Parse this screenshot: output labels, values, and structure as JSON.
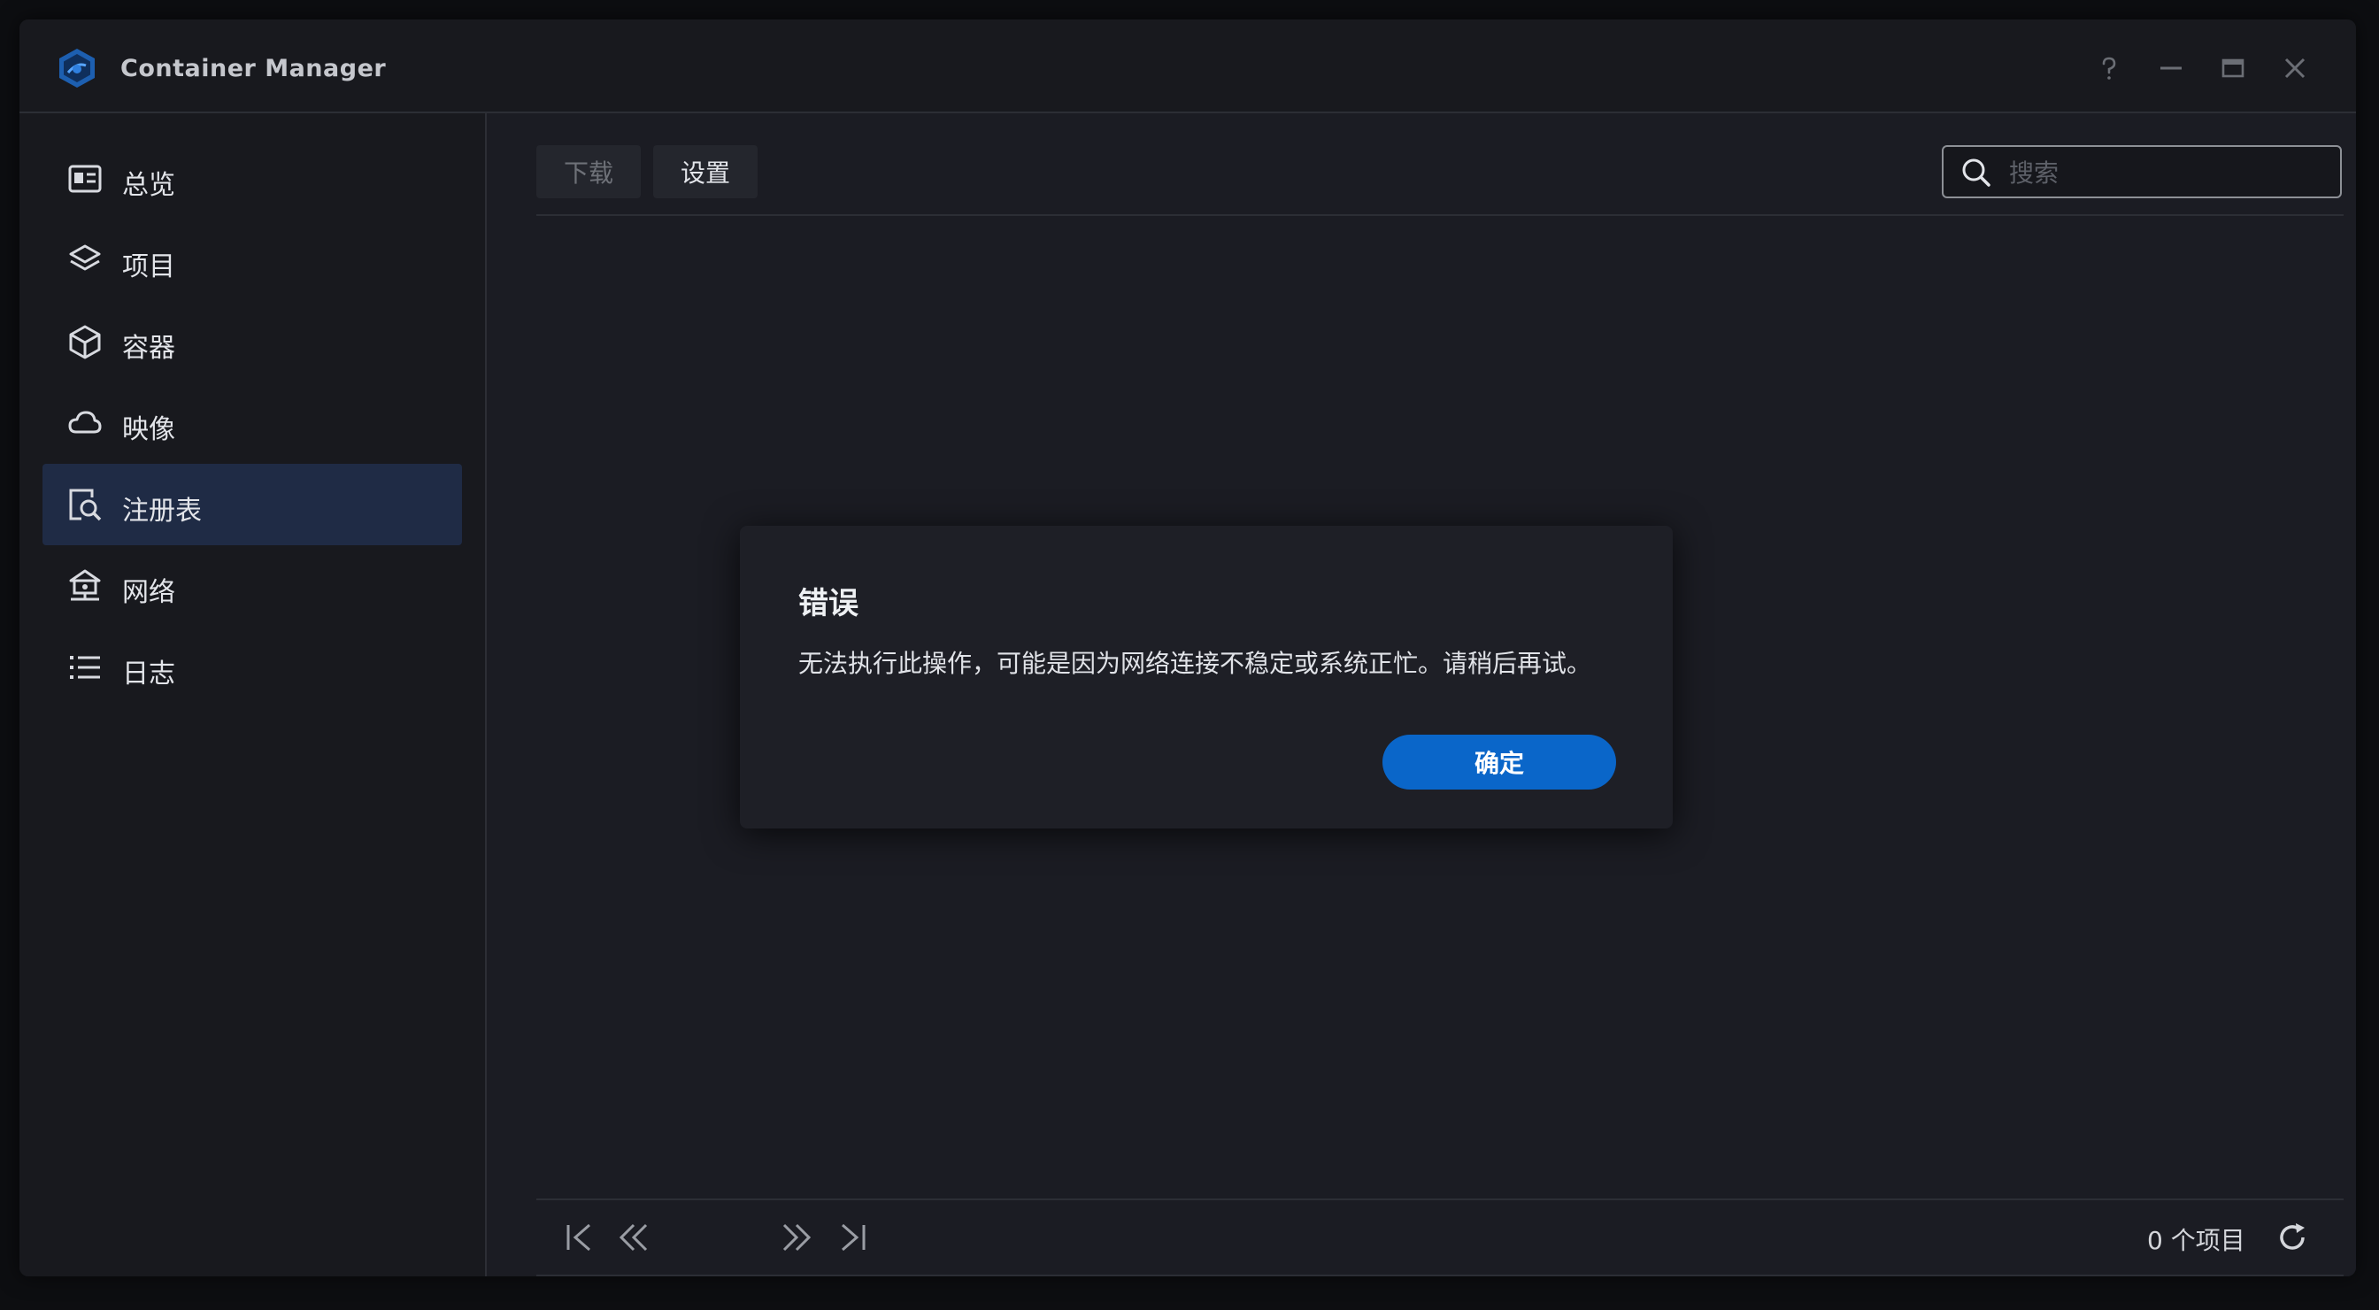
{
  "window": {
    "title": "Container Manager",
    "controls": {
      "help_icon": "question-mark",
      "minimize_icon": "minus",
      "maximize_icon": "square",
      "close_icon": "x"
    }
  },
  "sidebar": {
    "items": [
      {
        "label": "总览",
        "icon": "overview-card-icon",
        "active": false
      },
      {
        "label": "项目",
        "icon": "layers-icon",
        "active": false
      },
      {
        "label": "容器",
        "icon": "cube-icon",
        "active": false
      },
      {
        "label": "映像",
        "icon": "cloud-icon",
        "active": false
      },
      {
        "label": "注册表",
        "icon": "registry-search-icon",
        "active": true
      },
      {
        "label": "网络",
        "icon": "network-home-icon",
        "active": false
      },
      {
        "label": "日志",
        "icon": "list-icon",
        "active": false
      }
    ]
  },
  "toolbar": {
    "download_label": "下载",
    "settings_label": "设置",
    "search_placeholder": "搜索"
  },
  "footer": {
    "count_text": "0 个项目"
  },
  "dialog": {
    "title": "错误",
    "message": "无法执行此操作，可能是因为网络连接不稳定或系统正忙。请稍后再试。",
    "ok_label": "确定"
  },
  "colors": {
    "accent": "#0a66c9",
    "active_nav": "#1f2b45",
    "background": "#1b1c23"
  }
}
